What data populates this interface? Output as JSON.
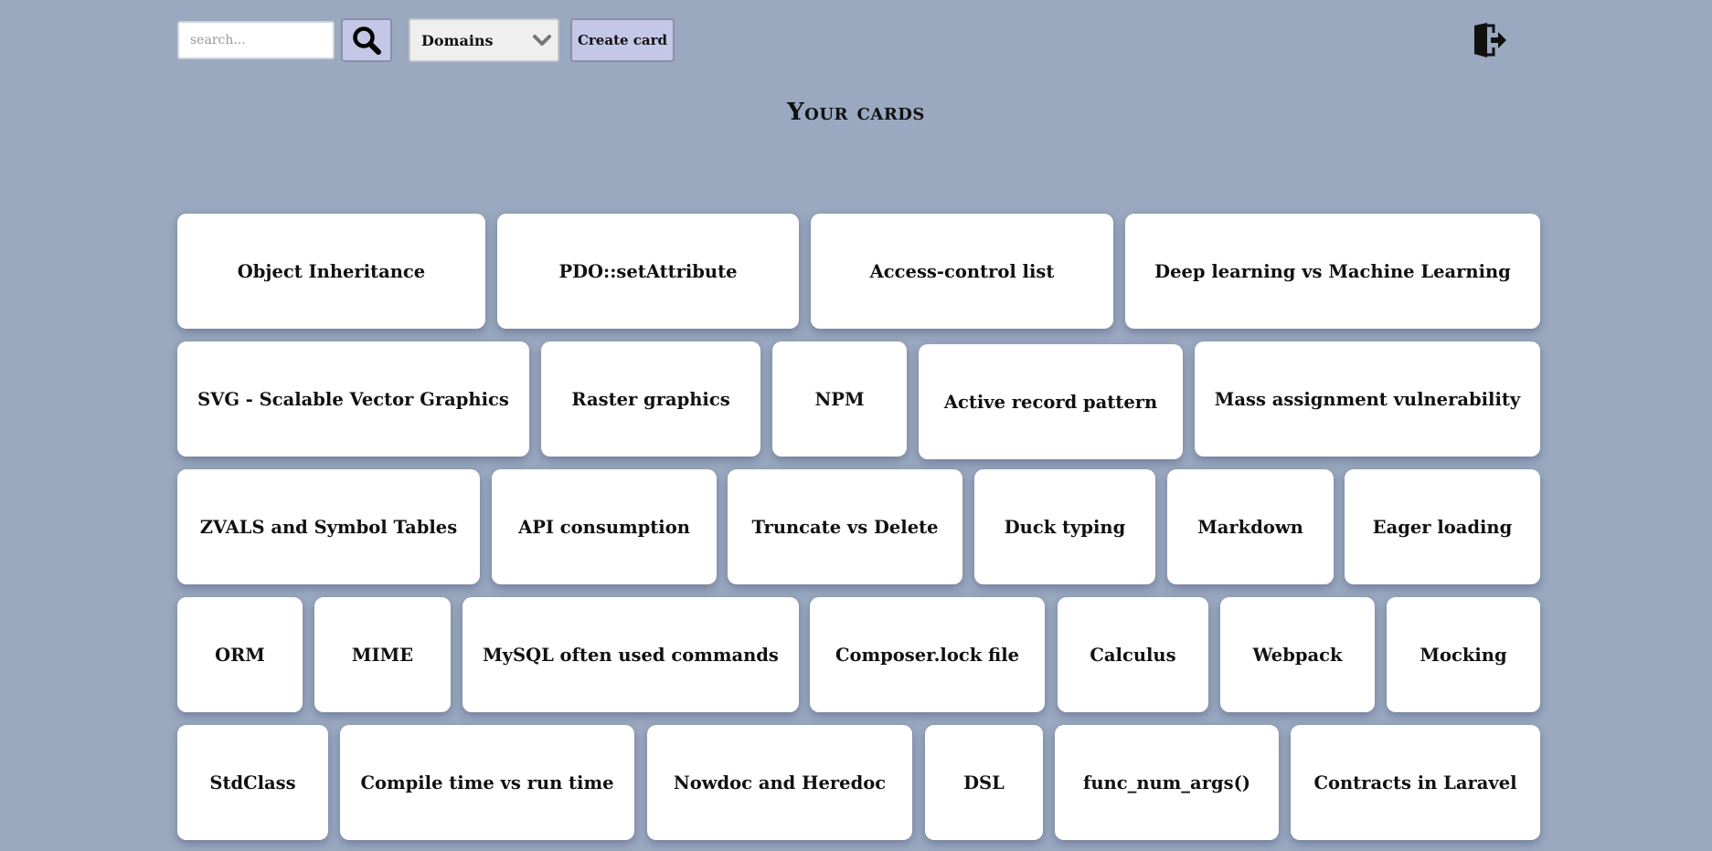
{
  "search": {
    "placeholder": "search..."
  },
  "toolbar": {
    "search_icon": "search-icon",
    "domains_label": "Domains",
    "create_label": "Create card",
    "logout_icon": "logout-icon"
  },
  "page": {
    "title": "Your cards"
  },
  "colors": {
    "background": "#9aa8c0",
    "button": "#c4c7e6",
    "card": "#ffffff"
  },
  "cards": [
    "Object Inheritance",
    "PDO::setAttribute",
    "Access-control list",
    "Deep learning vs Machine Learning",
    "SVG - Scalable Vector Graphics",
    "Raster graphics",
    "NPM",
    "Active record pattern",
    "Mass assignment vulnerability",
    "ZVALS and Symbol Tables",
    "API consumption",
    "Truncate vs Delete",
    "Duck typing",
    "Markdown",
    "Eager loading",
    "ORM",
    "MIME",
    "MySQL often used commands",
    "Composer.lock file",
    "Calculus",
    "Webpack",
    "Mocking",
    "StdClass",
    "Compile time vs run time",
    "Nowdoc and Heredoc",
    "DSL",
    "func_num_args()",
    "Contracts in Laravel"
  ]
}
